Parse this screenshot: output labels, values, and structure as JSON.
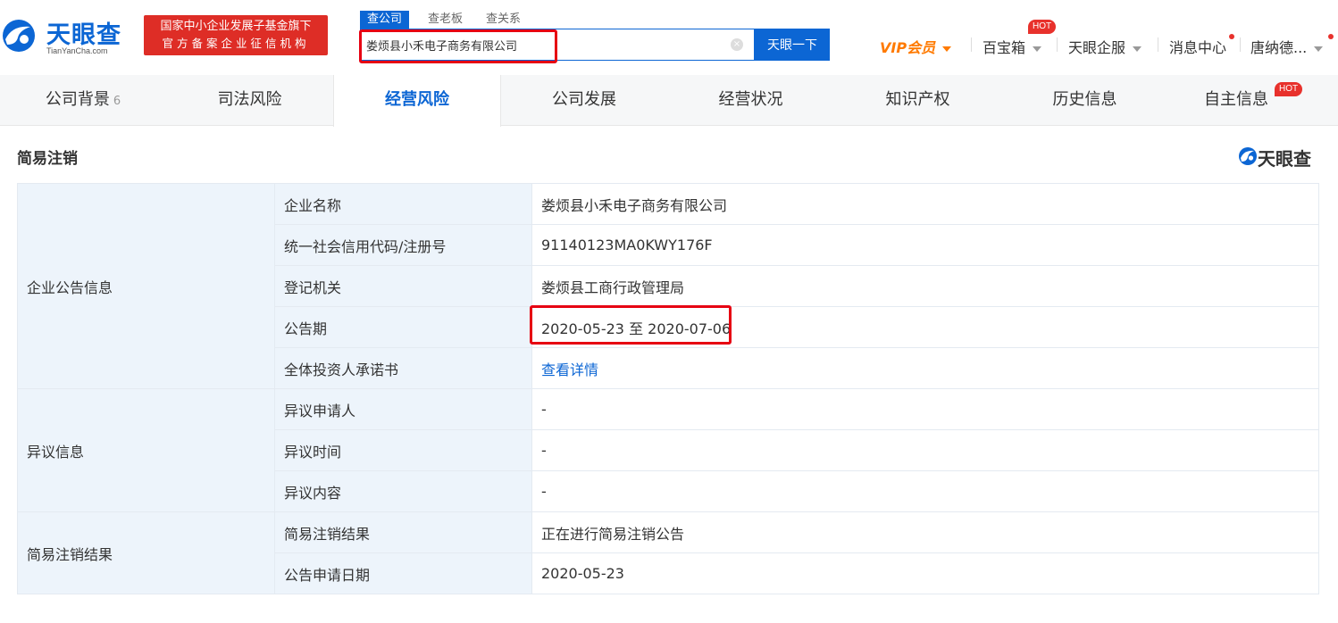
{
  "brand": {
    "name": "天眼查",
    "domain": "TianYanCha.com",
    "badge_line1": "国家中小企业发展子基金旗下",
    "badge_line2": "官方备案企业征信机构",
    "accent": "#0c66d4",
    "badge_color": "#de2d26"
  },
  "search": {
    "tabs": [
      "查公司",
      "查老板",
      "查关系"
    ],
    "active_tab": "查公司",
    "query": "娄烦县小禾电子商务有限公司",
    "button": "天眼一下"
  },
  "topnav": {
    "vip": "VIP会员",
    "baobox": "百宝箱",
    "baobox_badge": "HOT",
    "enterprise": "天眼企服",
    "messages": "消息中心",
    "user": "唐纳德..."
  },
  "tabs": [
    {
      "label": "公司背景",
      "count": "6"
    },
    {
      "label": "司法风险"
    },
    {
      "label": "经营风险",
      "active": true
    },
    {
      "label": "公司发展"
    },
    {
      "label": "经营状况"
    },
    {
      "label": "知识产权"
    },
    {
      "label": "历史信息"
    },
    {
      "label": "自主信息",
      "badge": "HOT"
    }
  ],
  "section": {
    "title": "简易注销",
    "watermark": "天眼查"
  },
  "groups": [
    {
      "name": "企业公告信息",
      "rows": [
        {
          "label": "企业名称",
          "value": "娄烦县小禾电子商务有限公司"
        },
        {
          "label": "统一社会信用代码/注册号",
          "value": "91140123MA0KWY176F"
        },
        {
          "label": "登记机关",
          "value": "娄烦县工商行政管理局"
        },
        {
          "label": "公告期",
          "value": "2020-05-23 至 2020-07-06"
        },
        {
          "label": "全体投资人承诺书",
          "value": "查看详情"
        }
      ]
    },
    {
      "name": "异议信息",
      "rows": [
        {
          "label": "异议申请人",
          "value": "-"
        },
        {
          "label": "异议时间",
          "value": "-"
        },
        {
          "label": "异议内容",
          "value": "-"
        }
      ]
    },
    {
      "name": "简易注销结果",
      "rows": [
        {
          "label": "简易注销结果",
          "value": "正在进行简易注销公告"
        },
        {
          "label": "公告申请日期",
          "value": "2020-05-23"
        }
      ]
    }
  ]
}
